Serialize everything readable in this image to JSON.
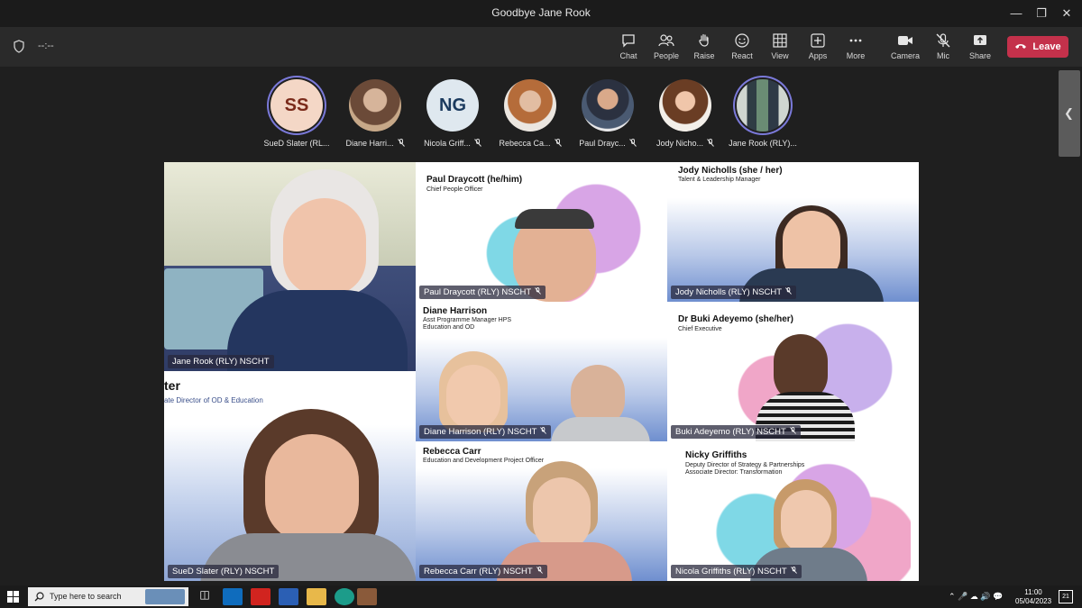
{
  "window": {
    "title": "Goodbye Jane Rook"
  },
  "meeting": {
    "timer": "--:--"
  },
  "toolbar": {
    "buttons": [
      {
        "label": "Chat",
        "icon": "chat-icon"
      },
      {
        "label": "People",
        "icon": "people-icon"
      },
      {
        "label": "Raise",
        "icon": "raise-hand-icon"
      },
      {
        "label": "React",
        "icon": "react-icon"
      },
      {
        "label": "View",
        "icon": "view-icon"
      },
      {
        "label": "Apps",
        "icon": "apps-icon"
      },
      {
        "label": "More",
        "icon": "more-icon"
      },
      {
        "label": "Camera",
        "icon": "camera-icon"
      },
      {
        "label": "Mic",
        "icon": "mic-muted-icon"
      },
      {
        "label": "Share",
        "icon": "share-icon"
      }
    ],
    "leave_label": "Leave"
  },
  "participants_strip": [
    {
      "initials": "SS",
      "name": "SueD Slater (RL...",
      "bg": "#f4d7c6",
      "fg": "#7a2a1a",
      "ring": true
    },
    {
      "initials": "",
      "name": "Diane Harri...",
      "bg": "#8b6b57",
      "muted": true
    },
    {
      "initials": "NG",
      "name": "Nicola Griff...",
      "bg": "#dfe8ef",
      "fg": "#1b3a5e",
      "muted": true
    },
    {
      "initials": "",
      "name": "Rebecca Ca...",
      "bg": "#b08a74",
      "muted": true
    },
    {
      "initials": "",
      "name": "Paul Drayc...",
      "bg": "#6b7a8c",
      "muted": true
    },
    {
      "initials": "",
      "name": "Jody Nicho...",
      "bg": "#a07a62",
      "muted": true
    },
    {
      "initials": "",
      "name": "Jane Rook (RLY)...",
      "bg": "#5d7b62",
      "ring": true
    }
  ],
  "tiles": {
    "jane": {
      "name": "Jane Rook (RLY) NSCHT"
    },
    "sued": {
      "name": "SueD Slater (RLY) NSCHT",
      "slide_title": "ter",
      "slide_sub": "ate Director of OD & Education"
    },
    "paul": {
      "name": "Paul Draycott (RLY) NSCHT",
      "slide_title": "Paul Draycott (he/him)",
      "slide_sub": "Chief People Officer"
    },
    "jody": {
      "name": "Jody Nicholls (RLY) NSCHT",
      "slide_title": "Jody Nicholls (she / her)",
      "slide_sub": "Talent & Leadership Manager"
    },
    "diane": {
      "name": "Diane Harrison (RLY) NSCHT",
      "slide_title": "Diane Harrison",
      "slide_sub": "Asst Programme Manager HPS",
      "slide_sub2": "Education and OD"
    },
    "buki": {
      "name": "Buki Adeyemo (RLY) NSCHT",
      "slide_title": "Dr Buki Adeyemo (she/her)",
      "slide_sub": "Chief Executive"
    },
    "rebecca": {
      "name": "Rebecca Carr (RLY) NSCHT",
      "slide_title": "Rebecca Carr",
      "slide_sub": "Education and Development Project Officer"
    },
    "nicola": {
      "name": "Nicola Griffiths (RLY) NSCHT",
      "slide_title": "Nicky Griffiths",
      "slide_sub": "Deputy Director of Strategy & Partnerships",
      "slide_sub2": "Associate Director: Transformation"
    }
  },
  "taskbar": {
    "search_placeholder": "Type here to search",
    "time": "11:00",
    "date": "05/04/2023",
    "notifications": "21"
  },
  "colors": {
    "leave": "#c4314b",
    "accent_ring": "#7a79d9",
    "nametag_bg": "#28283c"
  }
}
